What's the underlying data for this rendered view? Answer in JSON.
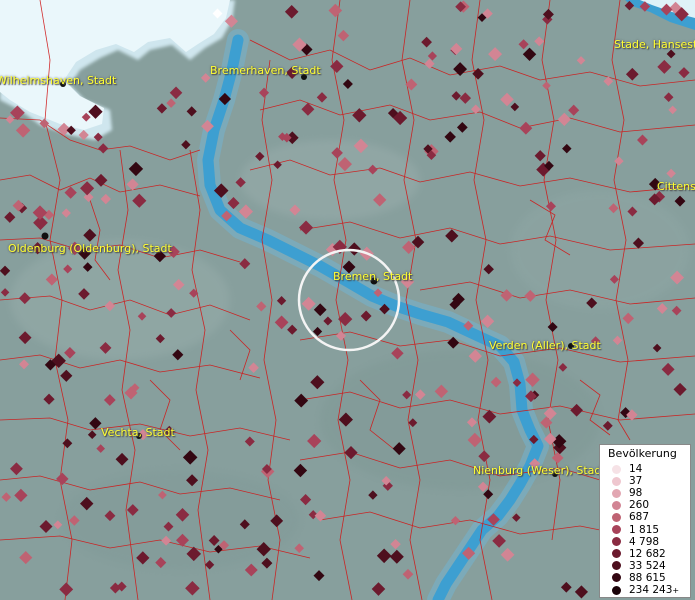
{
  "cities": [
    {
      "name": "Wilhelmshaven, Stadt"
    },
    {
      "name": "Bremerhaven, Stadt"
    },
    {
      "name": "Stade, Hansestadt"
    },
    {
      "name": "Oldenburg (Oldenburg), Stadt"
    },
    {
      "name": "Bremen, Stadt"
    },
    {
      "name": "Verden (Aller), Stadt"
    },
    {
      "name": "Vechta, Stadt"
    },
    {
      "name": "Nienburg (Weser), Stadt"
    },
    {
      "name": "Cittense"
    }
  ],
  "legend": {
    "title": "Bevölkerung",
    "items": [
      {
        "label": "14",
        "color": "#f6e2e6"
      },
      {
        "label": "37",
        "color": "#efc7cf"
      },
      {
        "label": "98",
        "color": "#e2a7b2"
      },
      {
        "label": "260",
        "color": "#d28594"
      },
      {
        "label": "687",
        "color": "#bf6373"
      },
      {
        "label": "1 815",
        "color": "#a8435a"
      },
      {
        "label": "4 798",
        "color": "#8a2b42"
      },
      {
        "label": "12 682",
        "color": "#6c1a2e"
      },
      {
        "label": "33 524",
        "color": "#4e0f1e"
      },
      {
        "label": "88 615",
        "color": "#330712"
      },
      {
        "label": "234 243",
        "color": "#1a0208",
        "suffix": "+"
      }
    ]
  },
  "colors": {
    "land": "#879f9d",
    "water": "#3d9fd1",
    "sea": "#dff2f8",
    "boundary": "#d01818",
    "label": "#ffff33"
  },
  "icons": [
    "selection-ring",
    "settlement-marker"
  ]
}
